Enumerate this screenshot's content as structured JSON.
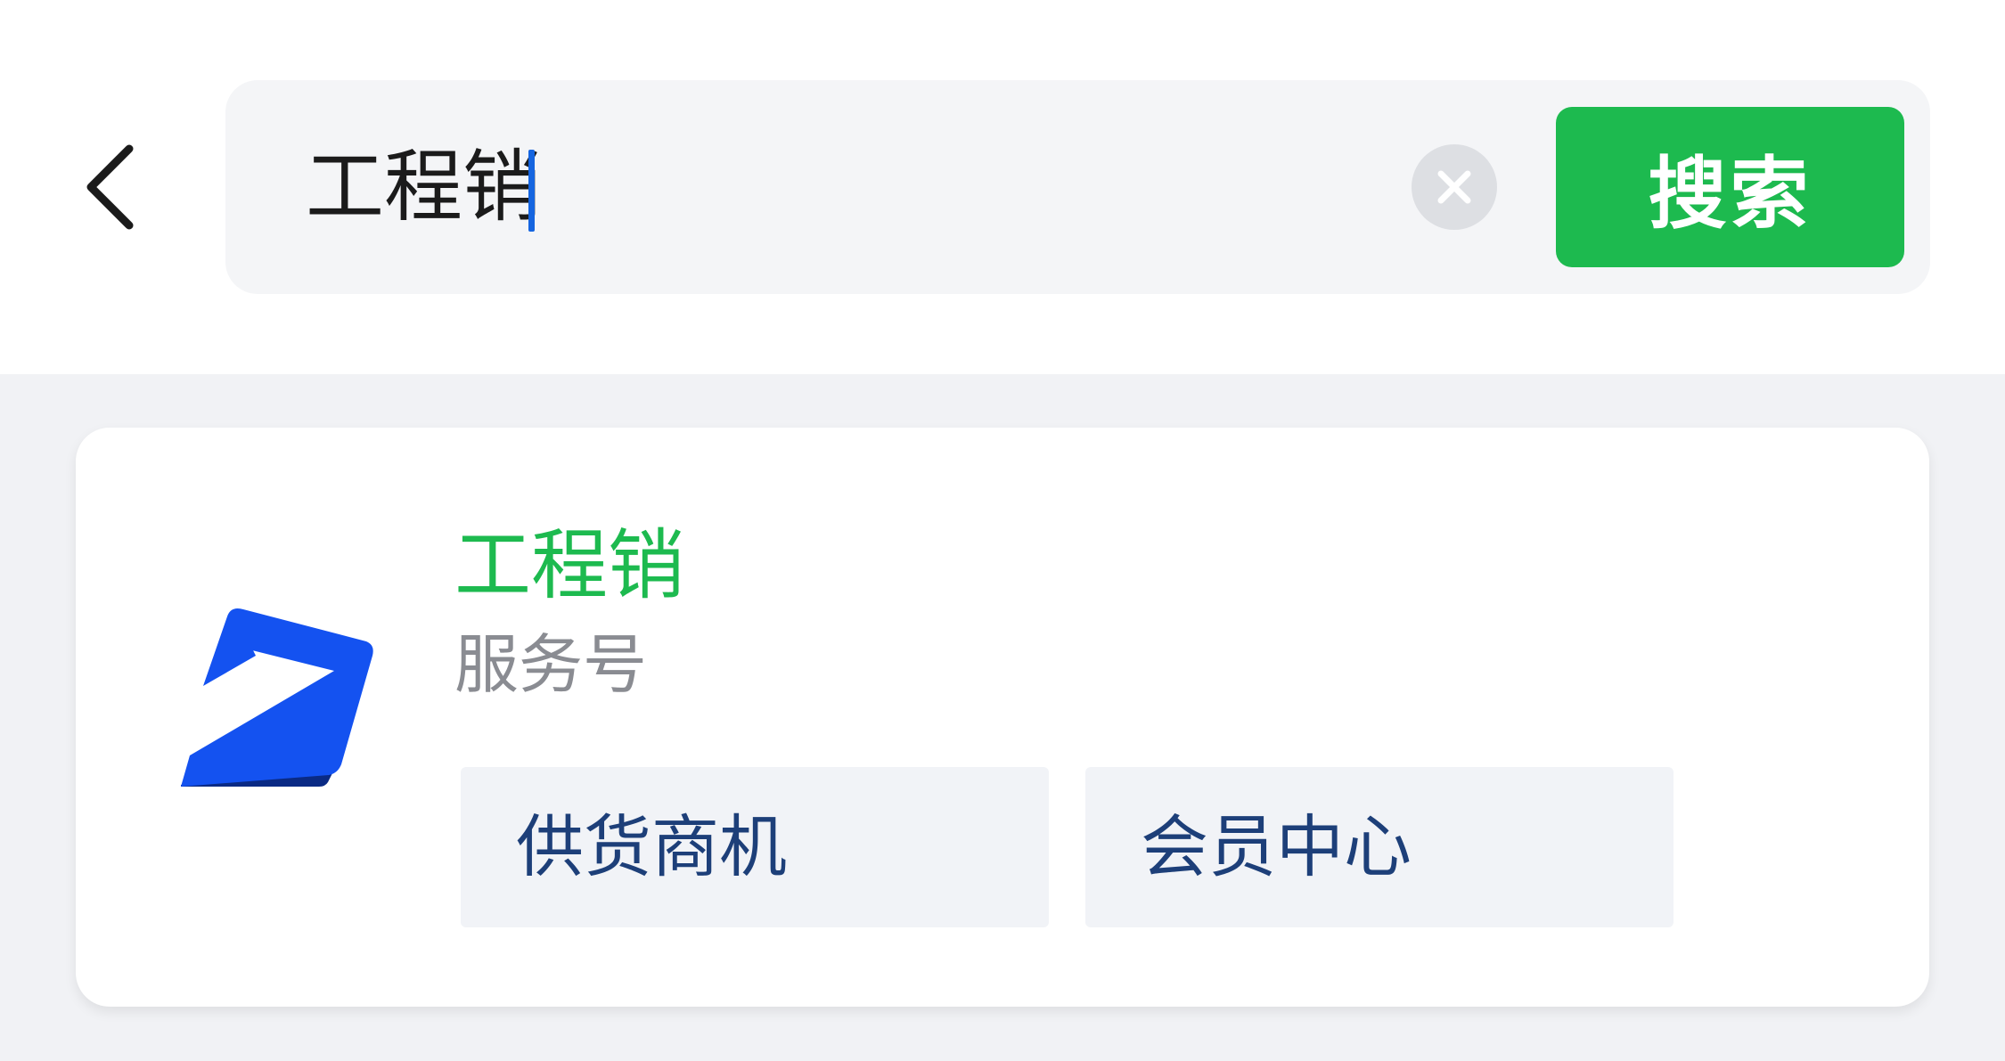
{
  "header": {
    "back_icon": "chevron-left-icon",
    "search": {
      "value": "工程销",
      "clear_icon": "clear-icon"
    },
    "search_button_label": "搜索"
  },
  "result": {
    "logo_icon": "brand-logo",
    "name": "工程销",
    "type": "服务号",
    "menu": [
      {
        "label": "供货商机"
      },
      {
        "label": "会员中心"
      }
    ]
  },
  "colors": {
    "accent_green": "#1dba4f",
    "caret_blue": "#1565e0",
    "menu_text": "#1d3f79",
    "logo_blue": "#1452f0",
    "logo_dark": "#0a2a84"
  }
}
